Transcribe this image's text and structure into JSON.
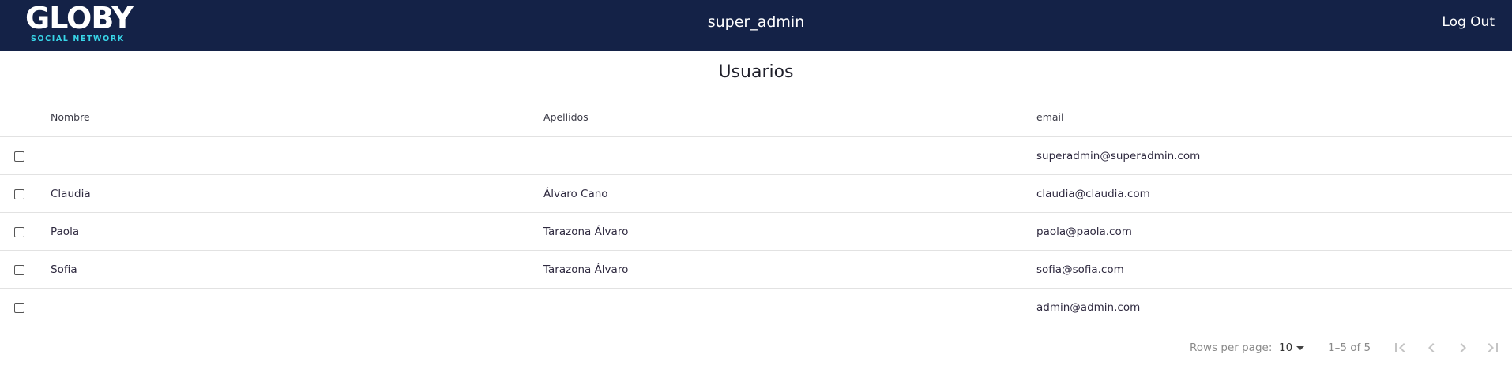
{
  "header": {
    "logo_main": "GLOBY",
    "logo_sub": "SOCIAL NETWORK",
    "username": "super_admin",
    "logout_label": "Log Out"
  },
  "page": {
    "title": "Usuarios"
  },
  "table": {
    "columns": [
      "Nombre",
      "Apellidos",
      "email"
    ],
    "rows": [
      {
        "nombre": "",
        "apellidos": "",
        "email": "superadmin@superadmin.com",
        "checked": false
      },
      {
        "nombre": "Claudia",
        "apellidos": "Álvaro Cano",
        "email": "claudia@claudia.com",
        "checked": false
      },
      {
        "nombre": "Paola",
        "apellidos": "Tarazona Álvaro",
        "email": "paola@paola.com",
        "checked": false
      },
      {
        "nombre": "Sofia",
        "apellidos": "Tarazona Álvaro",
        "email": "sofia@sofia.com",
        "checked": false
      },
      {
        "nombre": "",
        "apellidos": "",
        "email": "admin@admin.com",
        "checked": false
      }
    ]
  },
  "pagination": {
    "rows_per_page_label": "Rows per page:",
    "rows_per_page_value": "10",
    "range_label": "1–5 of 5",
    "buttons": [
      "first-page-icon",
      "previous-page-icon",
      "next-page-icon",
      "last-page-icon"
    ]
  },
  "colors": {
    "header_bg": "#142247",
    "logo_accent": "#38d6e8"
  }
}
